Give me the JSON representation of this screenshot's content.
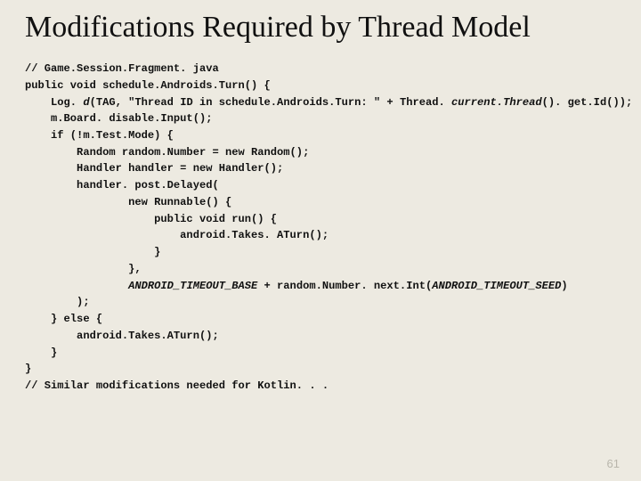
{
  "title": "Modifications Required by Thread Model",
  "code": {
    "l1": "// Game.Session.Fragment. java",
    "l2": "public void schedule.Androids.Turn() {",
    "l3a": "    Log. ",
    "l3b": "d",
    "l3c": "(TAG, \"Thread ID in schedule.Androids.Turn: \" + Thread. ",
    "l3d": "current.Thread",
    "l3e": "(). get.Id());",
    "l4": "    m.Board. disable.Input();",
    "l5": "    if (!m.Test.Mode) {",
    "l6": "        Random random.Number = new Random();",
    "l7": "        Handler handler = new Handler();",
    "l8": "        handler. post.Delayed(",
    "l9": "                new Runnable() {",
    "l10": "                    public void run() {",
    "l11": "                        android.Takes. ATurn();",
    "l12": "                    }",
    "l13": "                },",
    "l14a": "                ",
    "l14b": "ANDROID_TIMEOUT_BASE ",
    "l14c": "+ random.Number. next.Int(",
    "l14d": "ANDROID_TIMEOUT_SEED",
    "l14e": ")",
    "l15": "        );",
    "l16": "    } else {",
    "l17": "        android.Takes.ATurn();",
    "l18": "    }",
    "l19": "}",
    "l20": "// Similar modifications needed for Kotlin. . ."
  },
  "pageNumber": "61"
}
